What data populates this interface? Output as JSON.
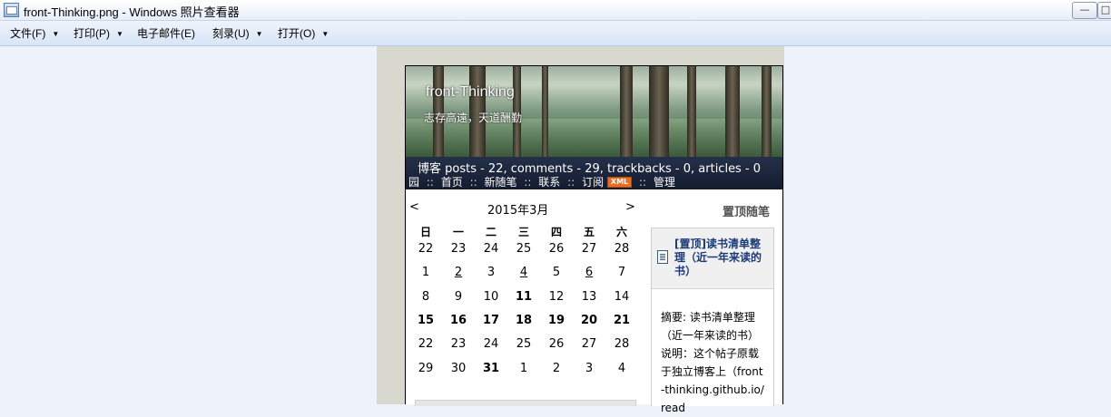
{
  "window": {
    "title": "front-Thinking.png - Windows 照片查看器",
    "minimize_label": "—",
    "maximize_label": "□"
  },
  "menu": {
    "items": [
      {
        "label": "文件(F)",
        "has_arrow": true
      },
      {
        "label": "打印(P)",
        "has_arrow": true
      },
      {
        "label": "电子邮件(E)",
        "has_arrow": false
      },
      {
        "label": "刻录(U)",
        "has_arrow": true
      },
      {
        "label": "打开(O)",
        "has_arrow": true
      }
    ],
    "arrow_glyph": "▼"
  },
  "blog": {
    "title": "front-Thinking",
    "subtitle": "志存高遠，天道酬勤",
    "stats": "博客  posts - 22, comments - 29, trackbacks - 0, articles - 0",
    "nav": {
      "prefix": "园",
      "separator": "::",
      "home": "首页",
      "new_post": "新随笔",
      "contact": "联系",
      "subscribe": "订阅",
      "xml_badge": "XML",
      "manage": "管理"
    }
  },
  "calendar": {
    "title": "2015年3月",
    "prev": "<",
    "next": ">",
    "weekdays": [
      "日",
      "一",
      "二",
      "三",
      "四",
      "五",
      "六"
    ],
    "weeks": [
      [
        "22",
        "23",
        "24",
        "25",
        "26",
        "27",
        "28"
      ],
      [
        "1",
        "2",
        "3",
        "4",
        "5",
        "6",
        "7"
      ],
      [
        "8",
        "9",
        "10",
        "11",
        "12",
        "13",
        "14"
      ],
      [
        "15",
        "16",
        "17",
        "18",
        "19",
        "20",
        "21"
      ],
      [
        "22",
        "23",
        "24",
        "25",
        "26",
        "27",
        "28"
      ],
      [
        "29",
        "30",
        "31",
        "1",
        "2",
        "3",
        "4"
      ]
    ],
    "linked_days": [
      [
        1,
        1
      ],
      [
        1,
        3
      ],
      [
        1,
        5
      ]
    ],
    "bold_days": [
      [
        2,
        3
      ],
      [
        3,
        0
      ],
      [
        3,
        1
      ],
      [
        3,
        2
      ],
      [
        3,
        3
      ],
      [
        3,
        4
      ],
      [
        3,
        5
      ],
      [
        3,
        6
      ],
      [
        5,
        2
      ]
    ]
  },
  "pinned": {
    "heading": "置顶随笔",
    "post_title": "[置顶]读书清单整理（近一年来读的书）",
    "summary": "摘要: 读书清单整理（近一年来读的书） 说明：这个帖子原载于独立博客上（front-thinking.github.io/read"
  }
}
